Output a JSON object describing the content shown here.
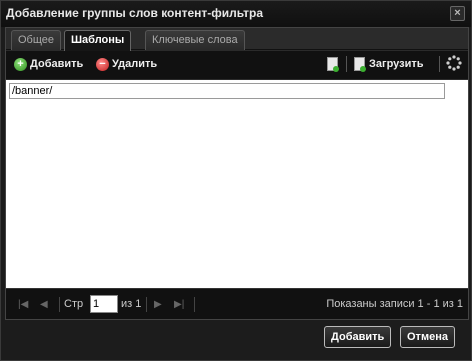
{
  "window": {
    "title": "Добавление группы слов контент-фильтра"
  },
  "tabs": [
    {
      "label": "Общее",
      "active": false
    },
    {
      "label": "Шаблоны",
      "active": true
    },
    {
      "label": "Ключевые слова",
      "active": false
    }
  ],
  "toolbar": {
    "add_label": "Добавить",
    "delete_label": "Удалить",
    "load_label": "Загрузить"
  },
  "grid": {
    "rows": [
      {
        "value": "/banner/"
      }
    ]
  },
  "pager": {
    "page_label": "Стр",
    "page_value": "1",
    "of_label": "из 1",
    "info": "Показаны записи 1 - 1 из 1"
  },
  "footer": {
    "add_label": "Добавить",
    "cancel_label": "Отмена"
  },
  "colors": {
    "background": "#1c1c1c",
    "panel": "#2b2b2b",
    "add_icon": "#3bb030",
    "delete_icon": "#d42a2a"
  }
}
